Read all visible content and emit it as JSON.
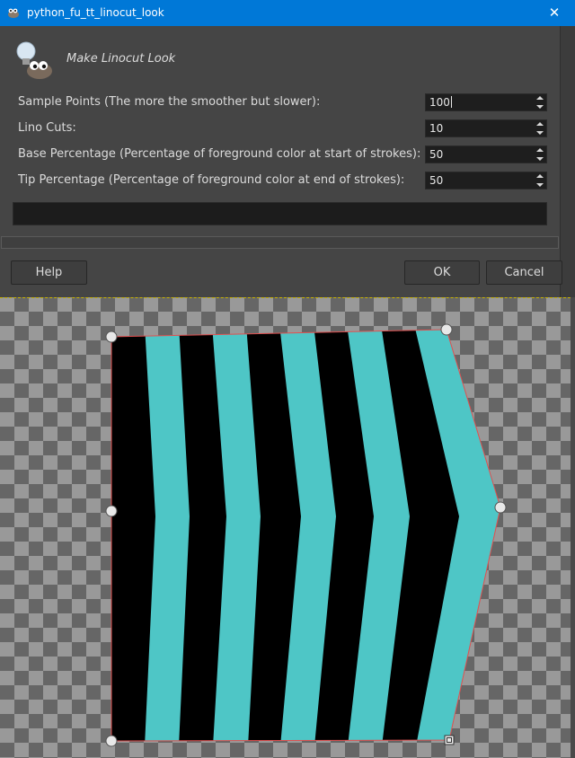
{
  "window": {
    "title": "python_fu_tt_linocut_look",
    "icon": "gimp-wilber-icon",
    "close_glyph": "✕"
  },
  "dialog": {
    "header_icon": "gimp-lightbulb-wilber-icon",
    "header_title": "Make Linocut Look",
    "fields": [
      {
        "label": "Sample Points (The more the smoother but slower):",
        "value": "100"
      },
      {
        "label": "Lino Cuts:",
        "value": "10"
      },
      {
        "label": "Base Percentage (Percentage of foreground color at start of strokes):",
        "value": "50"
      },
      {
        "label": "Tip Percentage (Percentage of foreground color at end of strokes):",
        "value": "50"
      }
    ],
    "buttons": {
      "help": "Help",
      "ok": "OK",
      "cancel": "Cancel"
    }
  },
  "canvas": {
    "colors": {
      "stripe_light": "#4ec6c6",
      "stripe_dark": "#000000",
      "path_outline": "#e05050",
      "handle": "#e8e8e8"
    }
  }
}
